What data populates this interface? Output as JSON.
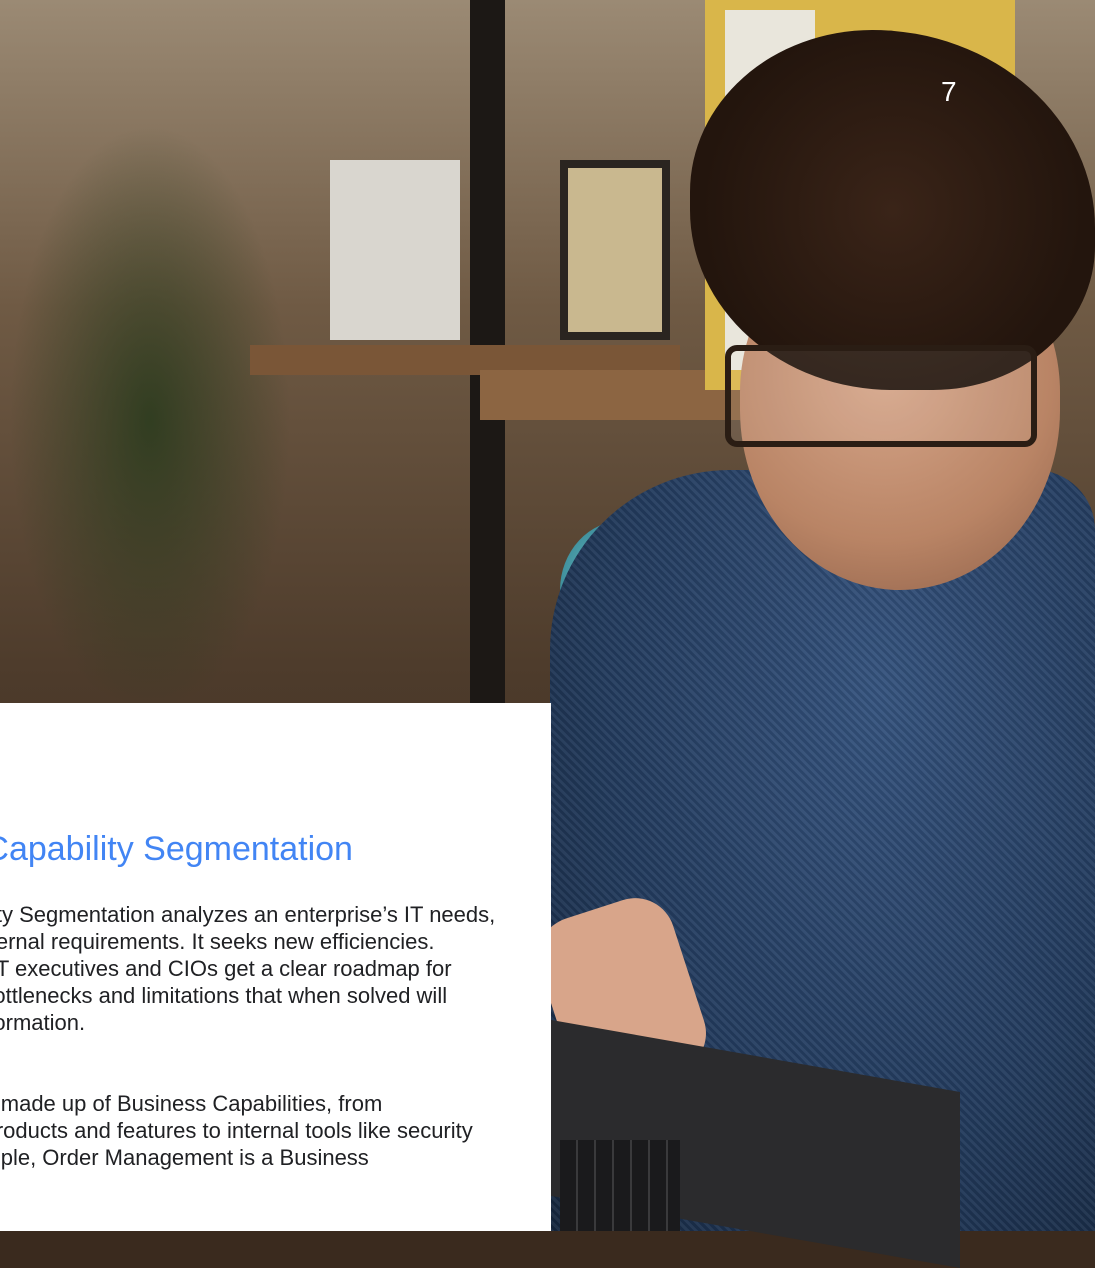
{
  "page": {
    "number": "7"
  },
  "section": {
    "heading": "Business Capability Segmentation",
    "paragraph1": [
      "Business Capability Segmentation analyzes an enterprise’s IT needs,",
      "resources, and internal requirements. It seeks new efficiencies.",
      "When done well, IT executives and CIOs get a clear roadmap for",
      "modernization—bottlenecks and limitations that when solved will",
      "drive digital transformation."
    ],
    "paragraph2": [
      "Organizations are made up of Business Capabilities, from",
      "customer-facing products and features to internal tools like security",
      "and HR. For example, Order Management is a Business"
    ]
  },
  "photo": {
    "description_icon": "photo-person-laptop"
  }
}
